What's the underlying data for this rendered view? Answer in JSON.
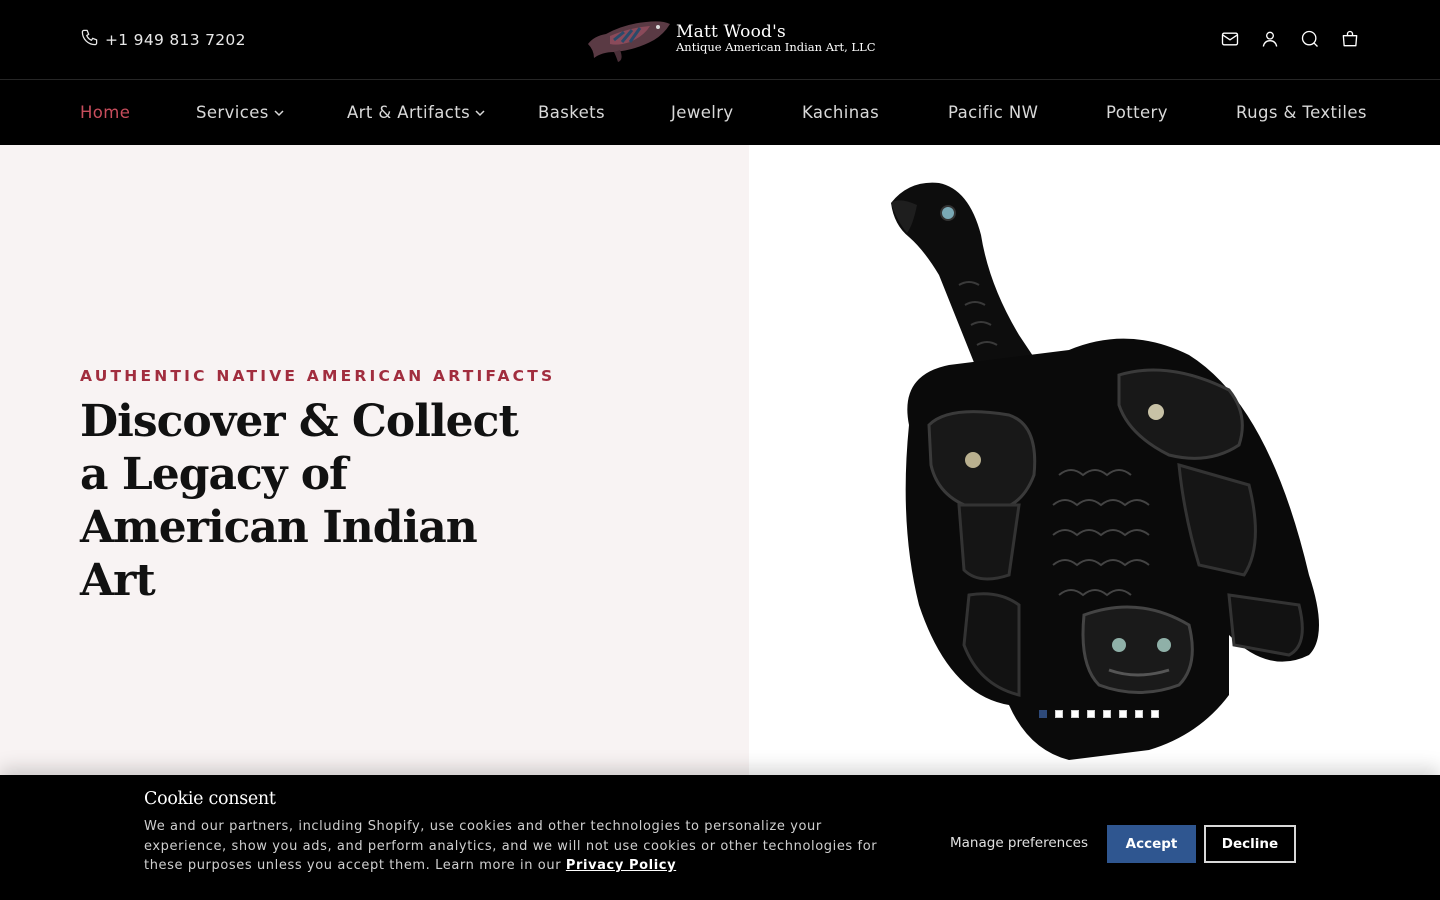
{
  "header": {
    "phone": "+1 949 813 7202",
    "logo": {
      "line1": "Matt Wood's",
      "line2": "Antique American Indian Art, LLC"
    },
    "icons": [
      "mail-icon",
      "account-icon",
      "search-icon",
      "cart-icon"
    ]
  },
  "nav": {
    "items": [
      {
        "label": "Home",
        "active": true
      },
      {
        "label": "Services",
        "dropdown": true
      },
      {
        "label": "Art & Artifacts",
        "dropdown": true
      },
      {
        "label": "Baskets"
      },
      {
        "label": "Jewelry"
      },
      {
        "label": "Kachinas"
      },
      {
        "label": "Pacific NW"
      },
      {
        "label": "Pottery"
      },
      {
        "label": "Rugs & Textiles"
      }
    ],
    "active_color": "#c74d5c"
  },
  "hero": {
    "eyebrow": "AUTHENTIC NATIVE AMERICAN ARTIFACTS",
    "headline": "Discover & Collect a Legacy of American Indian Art",
    "accent_color": "#a12d3e",
    "slider": {
      "count": 8,
      "active_index": 0
    }
  },
  "cookie": {
    "title": "Cookie consent",
    "body": "We and our partners, including Shopify, use cookies and other technologies to personalize your experience, show you ads, and perform analytics, and we will not use cookies or other technologies for these purposes unless you accept them. Learn more in our",
    "privacy_link": "Privacy Policy",
    "manage_label": "Manage preferences",
    "accept_label": "Accept",
    "decline_label": "Decline",
    "accept_color": "#2f5690"
  }
}
